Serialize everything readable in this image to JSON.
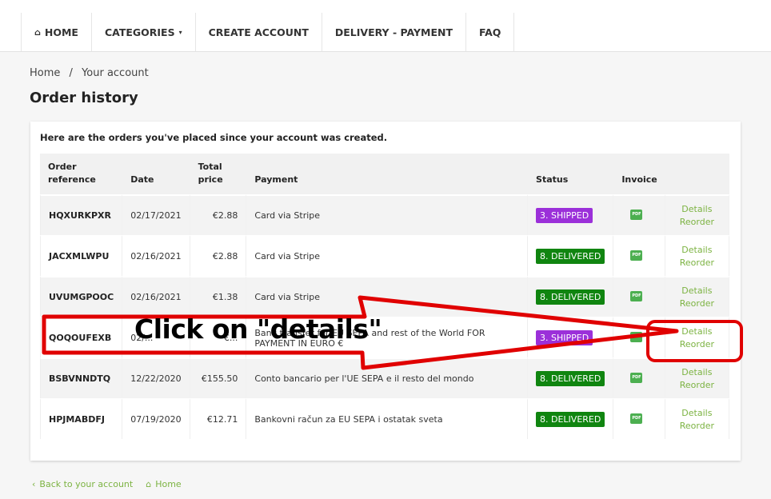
{
  "nav": {
    "home": "HOME",
    "categories": "CATEGORIES",
    "create_account": "CREATE ACCOUNT",
    "delivery_payment": "DELIVERY - PAYMENT",
    "faq": "FAQ"
  },
  "breadcrumb": {
    "home": "Home",
    "separator": "/",
    "current": "Your account"
  },
  "page_title": "Order history",
  "intro": "Here are the orders you've placed since your account was created.",
  "table": {
    "headers": {
      "reference": [
        "Order",
        "reference"
      ],
      "date": "Date",
      "total": [
        "Total",
        "price"
      ],
      "payment": "Payment",
      "status": "Status",
      "invoice": "Invoice"
    },
    "rows": [
      {
        "reference": "HQXURKPXR",
        "date": "02/17/2021",
        "price": "€2.88",
        "payment": "Card via Stripe",
        "status": "3. SHIPPED",
        "status_color": "#9b30d9",
        "details": "Details",
        "reorder": "Reorder"
      },
      {
        "reference": "JACXMLWPU",
        "date": "02/16/2021",
        "price": "€2.88",
        "payment": "Card via Stripe",
        "status": "8. DELIVERED",
        "status_color": "#108510",
        "details": "Details",
        "reorder": "Reorder"
      },
      {
        "reference": "UVUMGPOOC",
        "date": "02/16/2021",
        "price": "€1.38",
        "payment": "Card via Stripe",
        "status": "8. DELIVERED",
        "status_color": "#108510",
        "details": "Details",
        "reorder": "Reorder"
      },
      {
        "reference": "QOQOUFEXB",
        "date": "02/...",
        "price": "€...",
        "payment": "Bank transfer for EU SEPA and rest of the World FOR PAYMENT IN EURO €",
        "status": "3. SHIPPED",
        "status_color": "#9b30d9",
        "details": "Details",
        "reorder": "Reorder"
      },
      {
        "reference": "BSBVNNDTQ",
        "date": "12/22/2020",
        "price": "€155.50",
        "payment": "Conto bancario per l'UE SEPA e il resto del mondo",
        "status": "8. DELIVERED",
        "status_color": "#108510",
        "details": "Details",
        "reorder": "Reorder"
      },
      {
        "reference": "HPJMABDFJ",
        "date": "07/19/2020",
        "price": "€12.71",
        "payment": "Bankovni račun za EU SEPA i ostatak sveta",
        "status": "8. DELIVERED",
        "status_color": "#108510",
        "details": "Details",
        "reorder": "Reorder"
      }
    ]
  },
  "footer": {
    "back": "Back to your account",
    "home": "Home"
  },
  "annotation": {
    "text": "Click on \"details\"",
    "arrow_color": "#e00000"
  },
  "colors": {
    "link": "#7cb342",
    "shipped": "#9b30d9",
    "delivered": "#108510"
  }
}
